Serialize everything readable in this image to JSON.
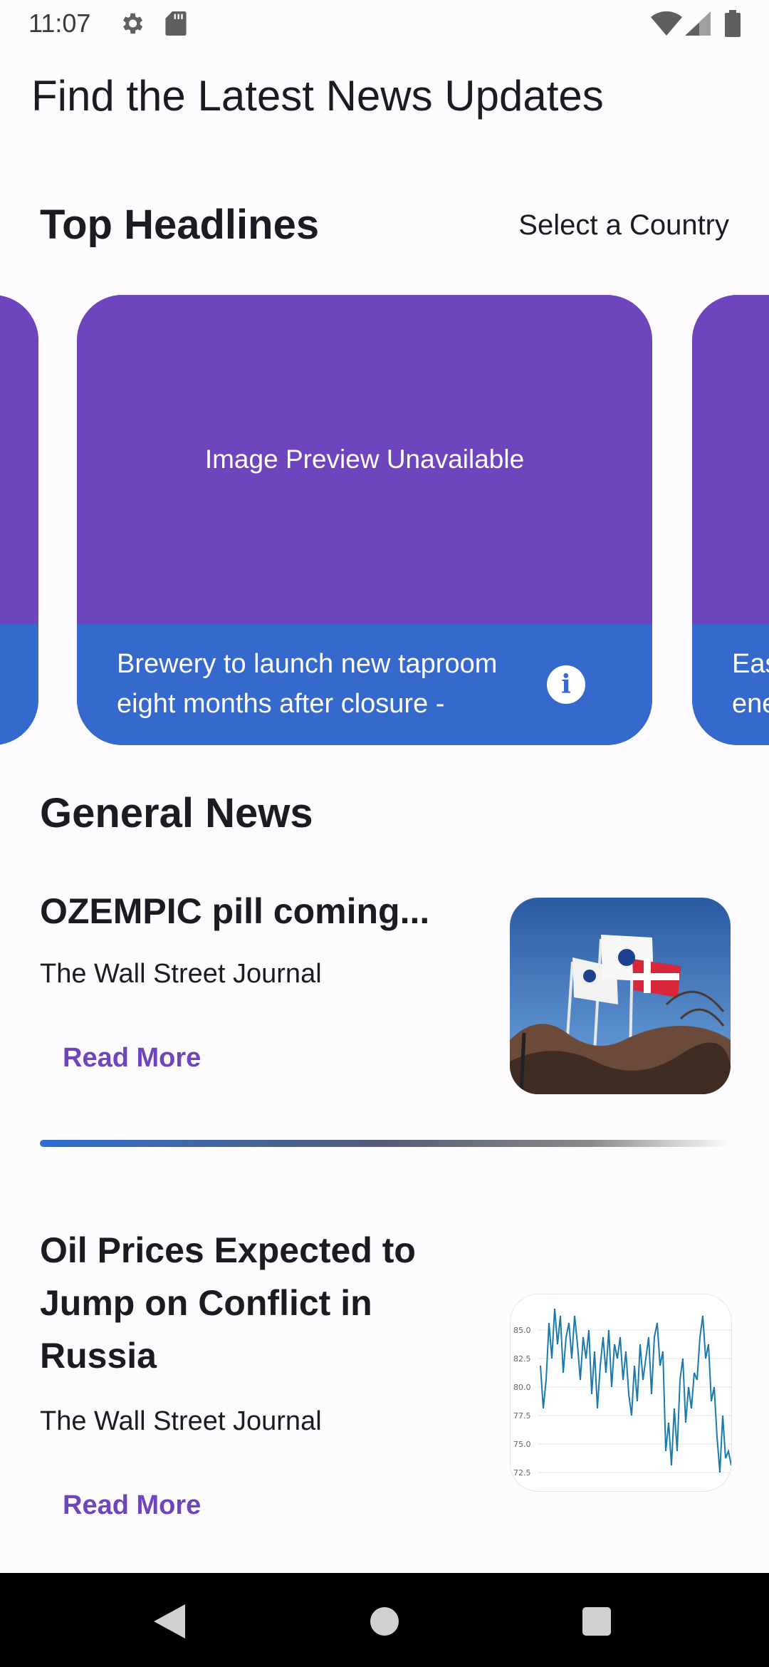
{
  "status_bar": {
    "time": "11:07"
  },
  "header": {
    "title": "Find the Latest News Updates"
  },
  "top_headlines": {
    "title": "Top Headlines",
    "select_country_label": "Select a Country",
    "cards": [
      {
        "image_text": "",
        "caption": ""
      },
      {
        "image_text": "Image Preview Unavailable",
        "caption": "Brewery to launch new taproom eight months after closure -"
      },
      {
        "image_text": "",
        "caption": "Eas ene"
      }
    ]
  },
  "general_news": {
    "title": "General News",
    "items": [
      {
        "title": "OZEMPIC pill coming...",
        "source": "The Wall Street Journal",
        "read_more": "Read More",
        "thumb_icon": "flags-photo"
      },
      {
        "title": "Oil Prices Expected to Jump on Conflict in Russia",
        "source": "The Wall Street Journal",
        "read_more": "Read More",
        "thumb_icon": "price-chart-photo"
      }
    ]
  },
  "thumb_chart": {
    "y_ticks": [
      "85.0",
      "82.5",
      "80.0",
      "77.5",
      "75.0",
      "72.5"
    ]
  },
  "colors": {
    "accent": "#6f45bd",
    "card_caption_bg": "#3569cc",
    "background": "#fefbff"
  }
}
